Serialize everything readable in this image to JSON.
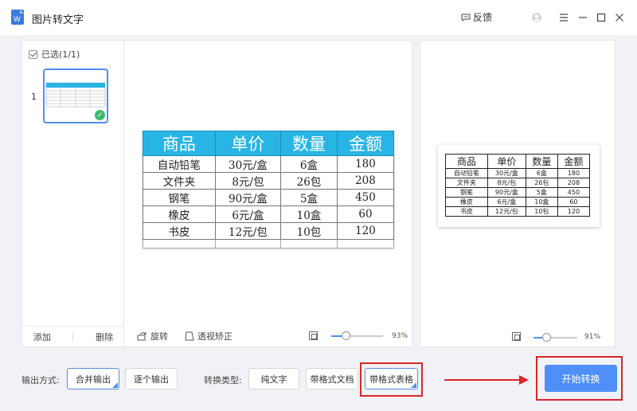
{
  "app": {
    "title": "图片转文字",
    "feedback_label": "反馈"
  },
  "titlebar_icons": [
    "feedback-icon",
    "user-avatar-icon",
    "menu-icon",
    "minimize-icon",
    "maximize-icon",
    "close-icon"
  ],
  "thumbs": {
    "select_all_label": "已选(1/1)",
    "items": [
      {
        "index": "1",
        "selected": true
      }
    ],
    "add_label": "添加",
    "delete_label": "删除"
  },
  "source_table": {
    "headers": [
      "商品",
      "单价",
      "数量",
      "金额"
    ],
    "rows": [
      [
        "自动铅笔",
        "30元/盒",
        "6盒",
        "180"
      ],
      [
        "文件夹",
        "8元/包",
        "26包",
        "208"
      ],
      [
        "钢笔",
        "90元/盒",
        "5盒",
        "450"
      ],
      [
        "橡皮",
        "6元/盒",
        "10盒",
        "60"
      ],
      [
        "书皮",
        "12元/包",
        "10包",
        "120"
      ]
    ]
  },
  "left_toolbar": {
    "rotate_label": "旋转",
    "perspective_label": "透视矫正",
    "zoom": "93%",
    "zoom_level": 0.93
  },
  "result_table": {
    "headers": [
      "商品",
      "单价",
      "数量",
      "金额"
    ],
    "rows": [
      [
        "自动铅笔",
        "30元/盒",
        "6盒",
        "180"
      ],
      [
        "文件夹",
        "8元/包",
        "26包",
        "208"
      ],
      [
        "钢笔",
        "90元/盒",
        "5盒",
        "450"
      ],
      [
        "橡皮",
        "6元/盒",
        "10盒",
        "60"
      ],
      [
        "书皮",
        "12元/包",
        "10包",
        "120"
      ]
    ]
  },
  "right_toolbar": {
    "zoom": "91%",
    "zoom_level": 0.91
  },
  "bottom": {
    "output_mode_label": "输出方式:",
    "output_modes": [
      "合并输出",
      "逐个输出"
    ],
    "output_mode_selected": "合并输出",
    "convert_type_label": "转换类型:",
    "convert_types": [
      "纯文字",
      "带格式文档",
      "带格式表格"
    ],
    "convert_type_selected": "带格式表格",
    "start_label": "开始转换"
  },
  "colors": {
    "accent": "#4f8ff7",
    "highlight": "#d9262b",
    "table_header": "#29b4e6"
  }
}
